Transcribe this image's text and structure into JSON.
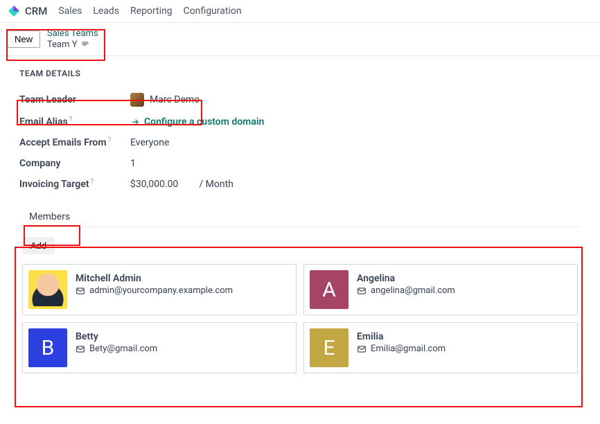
{
  "app": {
    "name": "CRM"
  },
  "nav": {
    "items": [
      "Sales",
      "Leads",
      "Reporting",
      "Configuration"
    ]
  },
  "actions": {
    "new_label": "New"
  },
  "breadcrumb": {
    "parent": "Sales Teams",
    "current": "Team Y"
  },
  "details": {
    "section_title": "TEAM DETAILS",
    "team_leader": {
      "label": "Team Leader",
      "value": "Marc Demo"
    },
    "email_alias": {
      "label": "Email Alias",
      "configure": "Configure a custom domain"
    },
    "accept_from": {
      "label": "Accept Emails From",
      "value": "Everyone"
    },
    "company": {
      "label": "Company",
      "value": "1"
    },
    "invoicing": {
      "label": "Invoicing Target",
      "value": "$30,000.00",
      "period": "/ Month"
    }
  },
  "tabs": {
    "members": "Members"
  },
  "members": {
    "add_label": "Add",
    "list": [
      {
        "name": "Mitchell Admin",
        "email": "admin@yourcompany.example.com",
        "initial": "",
        "color": "img"
      },
      {
        "name": "Angelina",
        "email": "angelina@gmail.com",
        "initial": "A",
        "color": "A"
      },
      {
        "name": "Betty",
        "email": "Bety@gmail.com",
        "initial": "B",
        "color": "B"
      },
      {
        "name": "Emilia",
        "email": "Emilia@gmail.com",
        "initial": "E",
        "color": "E"
      }
    ]
  }
}
